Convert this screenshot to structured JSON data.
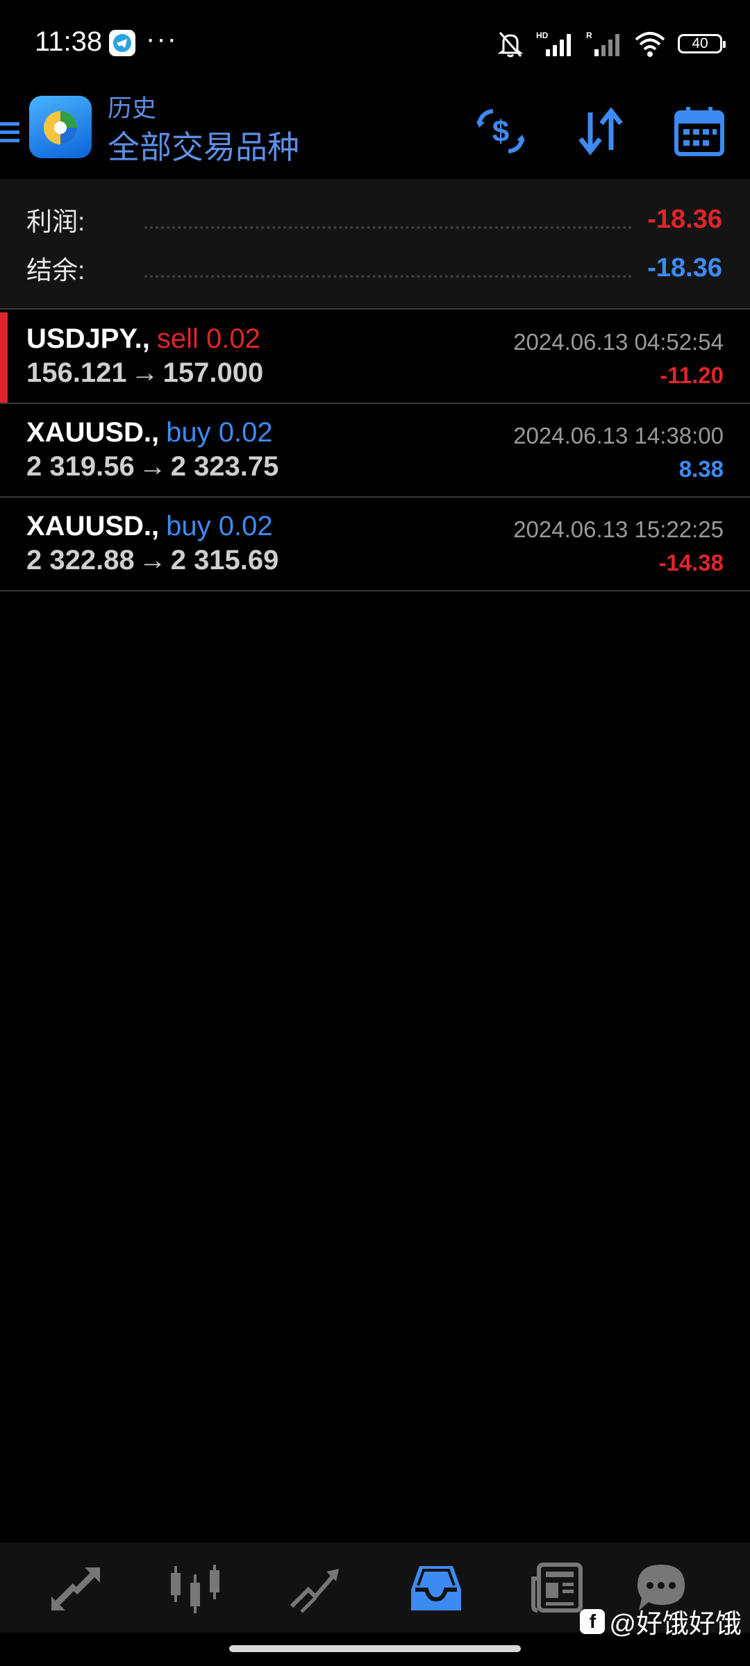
{
  "colors": {
    "accent": "#3d8bf2",
    "header_text": "#5d8fe6",
    "negative": "#e0242b",
    "positive": "#3d8bf2",
    "background": "#000000",
    "panel": "#141414"
  },
  "status_bar": {
    "time": "11:38",
    "app_icon": "telegram-icon",
    "more": "···",
    "battery": "40",
    "icons": [
      "bell-off-icon",
      "signal-hd-icon",
      "signal-r-icon",
      "wifi-icon",
      "battery-icon"
    ]
  },
  "header": {
    "subtitle": "历史",
    "title": "全部交易品种",
    "actions": [
      "currency-exchange-icon",
      "sort-icon",
      "calendar-icon"
    ]
  },
  "summary": {
    "profit_label": "利润:",
    "profit_value": "-18.36",
    "balance_label": "结余:",
    "balance_value": "-18.36"
  },
  "deals": [
    {
      "symbol": "USDJPY.,",
      "side": "sell 0.02",
      "open": "156.121",
      "arrow": "→",
      "close": "157.000",
      "time": "2024.06.13 04:52:54",
      "profit": "-11.20",
      "side_color": "#e0242b",
      "profit_color": "#e0242b"
    },
    {
      "symbol": "XAUUSD.,",
      "side": "buy 0.02",
      "open": "2 319.56",
      "arrow": "→",
      "close": "2 323.75",
      "time": "2024.06.13 14:38:00",
      "profit": "8.38",
      "side_color": "#3d8bf2",
      "profit_color": "#3d8bf2"
    },
    {
      "symbol": "XAUUSD.,",
      "side": "buy 0.02",
      "open": "2 322.88",
      "arrow": "→",
      "close": "2 315.69",
      "time": "2024.06.13 15:22:25",
      "profit": "-14.38",
      "side_color": "#3d8bf2",
      "profit_color": "#e0242b"
    }
  ],
  "bottom_nav": {
    "items": [
      "quotes-icon",
      "chart-icon",
      "trade-icon",
      "history-icon",
      "news-icon",
      "chat-icon"
    ],
    "active": "history-icon"
  },
  "watermark": {
    "text": "@好饿好饿",
    "badge": "f"
  }
}
